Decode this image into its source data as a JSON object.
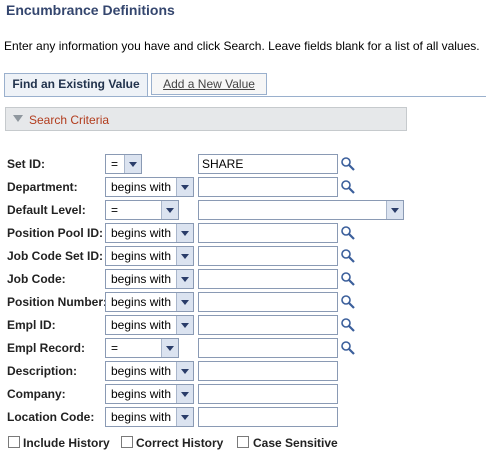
{
  "page": {
    "title": "Encumbrance Definitions",
    "instructions": "Enter any information you have and click Search. Leave fields blank for a list of all values."
  },
  "tabs": [
    {
      "label": "Find an Existing Value",
      "active": true
    },
    {
      "label": "Add a New Value",
      "active": false
    }
  ],
  "search_criteria": {
    "label": "Search Criteria"
  },
  "fields": [
    {
      "label": "Set ID:",
      "operator": "=",
      "value": "SHARE",
      "lookup": true
    },
    {
      "label": "Department:",
      "operator": "begins with",
      "value": "",
      "lookup": true
    },
    {
      "label": "Default Level:",
      "operator": "=",
      "value": "",
      "lookup": false
    },
    {
      "label": "Position Pool ID:",
      "operator": "begins with",
      "value": "",
      "lookup": true
    },
    {
      "label": "Job Code Set ID:",
      "operator": "begins with",
      "value": "",
      "lookup": true
    },
    {
      "label": "Job Code:",
      "operator": "begins with",
      "value": "",
      "lookup": true
    },
    {
      "label": "Position Number:",
      "operator": "begins with",
      "value": "",
      "lookup": true
    },
    {
      "label": "Empl ID:",
      "operator": "begins with",
      "value": "",
      "lookup": true
    },
    {
      "label": "Empl Record:",
      "operator": "=",
      "value": "",
      "lookup": true
    },
    {
      "label": "Description:",
      "operator": "begins with",
      "value": "",
      "lookup": false
    },
    {
      "label": "Company:",
      "operator": "begins with",
      "value": "",
      "lookup": false
    },
    {
      "label": "Location Code:",
      "operator": "begins with",
      "value": "",
      "lookup": false
    }
  ],
  "options": {
    "include_history": "Include History",
    "correct_history": "Correct History",
    "case_sensitive": "Case Sensitive"
  },
  "colors": {
    "title": "#34466e",
    "criteria_label": "#b23c1d",
    "tab_border": "#9ab0cd"
  }
}
